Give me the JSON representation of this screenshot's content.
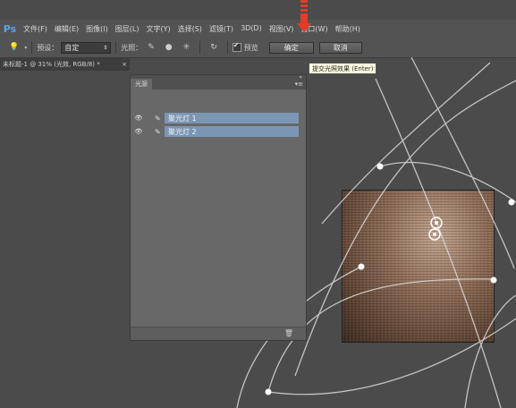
{
  "app": {
    "logo": "Ps"
  },
  "menubar": {
    "items": [
      "文件(F)",
      "编辑(E)",
      "图像(I)",
      "图层(L)",
      "文字(Y)",
      "选择(S)",
      "滤镜(T)",
      "3D(D)",
      "视图(V)",
      "窗口(W)",
      "帮助(H)"
    ]
  },
  "options": {
    "preset_label": "预设：",
    "preset_value": "自定",
    "light_label": "光照：",
    "preview_label": "预览",
    "ok_label": "确定",
    "cancel_label": "取消",
    "preview_checked": true
  },
  "tooltip": {
    "text": "提交光照效果 (Enter)"
  },
  "document": {
    "tab_title": "未标题-1 @ 31% (光效, RGB/8) *",
    "close": "×"
  },
  "lights_panel": {
    "tab": "光源",
    "collapse": "«",
    "menu": "▾≡",
    "lights": [
      {
        "label": "聚光灯 1",
        "visible": true
      },
      {
        "label": "聚光灯 2",
        "visible": true
      }
    ]
  },
  "icons": {
    "eye": "eye-icon",
    "spotlight": "spotlight-icon",
    "trash": "trash-icon"
  },
  "colors": {
    "ps_blue": "#5da3ea",
    "selection": "#7b96b5",
    "arrow_red": "#e23b2a",
    "tooltip_bg": "#ffffe1"
  }
}
